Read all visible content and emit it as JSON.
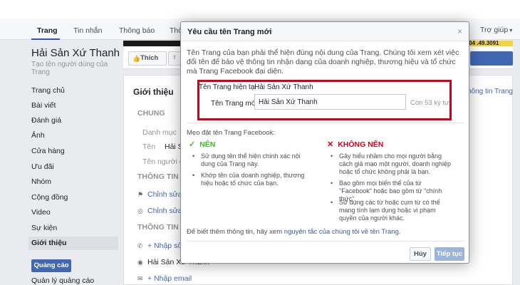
{
  "nav": {
    "tabs": [
      "Trang",
      "Tin nhắn",
      "Thông báo",
      "Thô"
    ],
    "help": "Trợ giúp"
  },
  "page": {
    "name": "Hải Sản Xứ Thanh",
    "username_prompt": "Tạo tên người dùng của Trang",
    "cover_phone": ".04 .49.3091",
    "like_label": "Thích"
  },
  "sidebar": {
    "items": [
      "Trang chủ",
      "Bài viết",
      "Đánh giá",
      "Ảnh",
      "Cửa hàng",
      "Ưu đãi",
      "Nhóm",
      "Cộng đồng",
      "Video",
      "Sự kiện",
      "Giới thiệu"
    ],
    "ads_button": "Quảng cáo",
    "ads_manage": "Quản lý quảng cáo"
  },
  "about": {
    "title": "Giới thiệu",
    "edit_link": "hông tin Trang",
    "general": "CHUNG",
    "category_label": "Danh mục",
    "name_label": "Tên",
    "name_value": "Hải S",
    "username_label": "Tên người d",
    "info_section": "THÔNG TIN D",
    "edit_1": "Chỉnh sửa",
    "edit_2": "Chỉnh sửa",
    "contact_section": "THÔNG TIN L",
    "add_phone": "+ Nhập số",
    "messenger": "Hải Sản Xứ Thanh",
    "add_email": "+ Nhập email"
  },
  "modal": {
    "title": "Yêu cầu tên Trang mới",
    "close": "×",
    "description": "Tên Trang của bạn phải thể hiện đúng nội dung của Trang. Chúng tôi xem xét việc đổi tên để bảo vệ thông tin nhận dạng của doanh nghiệp, thương hiệu và tổ chức mà Trang Facebook đại diện.",
    "current_label": "Tên Trang hiện tại",
    "current_value": "Hải Sản Xứ Thanh",
    "new_label": "Tên Trang mới",
    "new_value": "Hải Sản Xứ Thanh",
    "chars_left": "Còn 53 ký tự",
    "tips_label": "Mẹo đặt tên Trang Facebook:",
    "do_heading": "NÊN",
    "dont_heading": "KHÔNG NÊN",
    "do_tips": [
      "Sử dụng tên thể hiện chính xác nội dung của Trang này.",
      "Khớp tên của doanh nghiệp, thương hiệu hoặc tổ chức của bạn."
    ],
    "dont_tips": [
      "Gây hiểu nhầm cho mọi người bằng cách giả mạo một người, doanh nghiệp hoặc tổ chức không phải là bạn.",
      "Bao gồm mọi biến thể của từ \"Facebook\" hoặc bao gồm từ \"chính thức\".",
      "Sử dụng các từ hoặc cụm từ có thể mang tính lạm dụng hoặc vi phạm quyền của người khác."
    ],
    "footer_prefix": "Để biết thêm thông tin, hãy xem",
    "footer_link": "nguyên tắc của chúng tôi về tên Trang",
    "footer_suffix": ".",
    "cancel": "Hủy",
    "next": "Tiếp tục"
  },
  "colors": {
    "facebook_blue": "#4267b2",
    "highlight_red": "#d0021b",
    "do_green": "#42b72a"
  }
}
